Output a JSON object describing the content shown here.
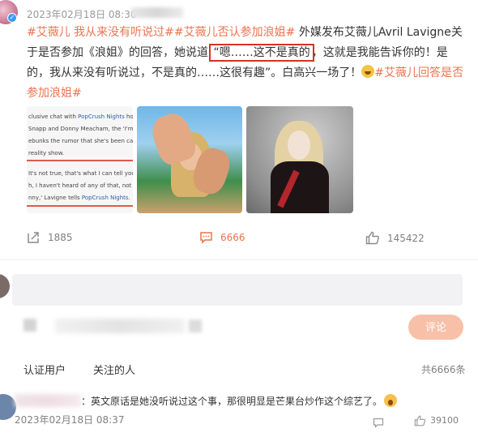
{
  "post": {
    "date": "2023年02月18日 08:30",
    "text": {
      "tag1": "#艾薇儿 我从来没有听说过#",
      "tag2": "#艾薇儿否认参加浪姐#",
      "part1": " 外媒发布艾薇儿Avril Lavigne关于是否参加《浪姐》的回答，她说道 ",
      "boxed": "“嗯……这不是真的",
      "part2": "，这就是我能告诉你的！是的，我从来没有听说过，不是真的……这很有趣”。白高兴一场了！",
      "tag3": "#艾薇儿回答是否参加浪姐#"
    },
    "image1": {
      "lines": [
        "clusive chat with PopCrush Nights ho",
        "Snapp and Donny Meacham, the 'I'm",
        "ebunks the rumor that she's been cas",
        "reality show.",
        "",
        "It's not true, that's what I can tell you",
        "h, I haven't heard of any of that, not t",
        "nny,' Lavigne tells PopCrush Nights."
      ],
      "highlight": "PopCrush Nights"
    },
    "actions": {
      "share_count": "1885",
      "comment_count": "6666",
      "like_count": "145422"
    }
  },
  "comment_box": {
    "value": "",
    "submit_label": "评论"
  },
  "comments_section": {
    "filters": [
      "认证用户",
      "关注的人"
    ],
    "total": "共6666条",
    "items": [
      {
        "text": "：英文原话是她没听说过这个事，那很明显是芒果台炒作这个综艺了。",
        "date": "2023年02月18日 08:37",
        "like_count": "39100"
      }
    ]
  },
  "colors": {
    "accent": "#eb7350",
    "highlight_box": "#d9302c",
    "verified_blue": "#3a9bf4",
    "submit_disabled": "#f8c0a8"
  },
  "icons": {
    "share": "share-icon",
    "comment": "comment-icon",
    "like": "thumbs-up-icon",
    "reply": "reply-icon"
  }
}
